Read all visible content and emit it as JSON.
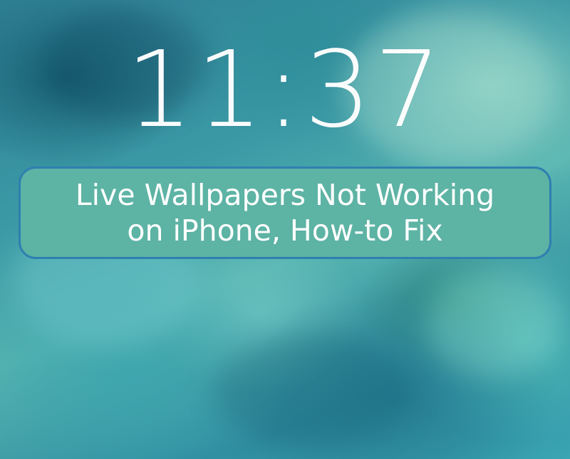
{
  "lock_screen": {
    "time": "11:37"
  },
  "banner": {
    "title_line1": "Live Wallpapers Not Working",
    "title_line2": "on iPhone, How-to Fix",
    "background_color": "#5db3a4",
    "border_color": "#2f7fb0"
  }
}
